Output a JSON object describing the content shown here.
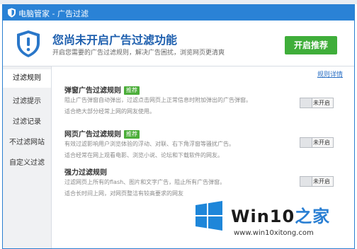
{
  "window": {
    "title": "电脑管家 - 广告过滤"
  },
  "header": {
    "title": "您尚未开启广告过滤功能",
    "subtitle": "开启您需要的广告过滤规则，解决广告困扰，浏览网页更清爽",
    "enable_button": "开启推荐"
  },
  "sidebar": {
    "items": [
      {
        "label": "过滤规则",
        "active": true
      },
      {
        "label": "过滤提示",
        "active": false
      },
      {
        "label": "过滤记录",
        "active": false
      },
      {
        "label": "不过滤网站",
        "active": false
      },
      {
        "label": "自定义过滤",
        "active": false
      }
    ]
  },
  "main": {
    "detail_link": "规则详情",
    "rules": [
      {
        "title": "弹窗广告过滤规则",
        "badge": "推荐",
        "desc1": "阻止广告弹窗自动弹出，过滤点击网页上正常信息时附加弹出的广告弹窗。",
        "desc2": "适合绝大部分经常上网的网友使用。",
        "toggle": "未开启"
      },
      {
        "title": "网页广告过滤规则",
        "badge": "推荐",
        "desc1": "有效过滤影响用户浏览体验的浮动、对联、右下角浮窗等骚扰广告。",
        "desc2": "适合经常在网上观看电影、浏览小说、论坛和下载软件的网友。",
        "toggle": "未开启"
      },
      {
        "title": "强力过滤规则",
        "badge": "",
        "desc1": "过滤网页上所有的flash、图片和文字广告，阻止所有广告弹窗。",
        "desc2": "适合长时间上网，对网页整洁有较高要求的网友",
        "toggle": "未开启"
      }
    ]
  },
  "watermark": {
    "brand": "Win10",
    "brand_zh": "之家",
    "url": "www.win10xitong.com"
  },
  "colors": {
    "titlebar": "#2a82d6",
    "enable_button": "#3fae3a",
    "badge": "#4cae3a",
    "header_title": "#1e5fae",
    "win_logo": "#1e86d9"
  }
}
